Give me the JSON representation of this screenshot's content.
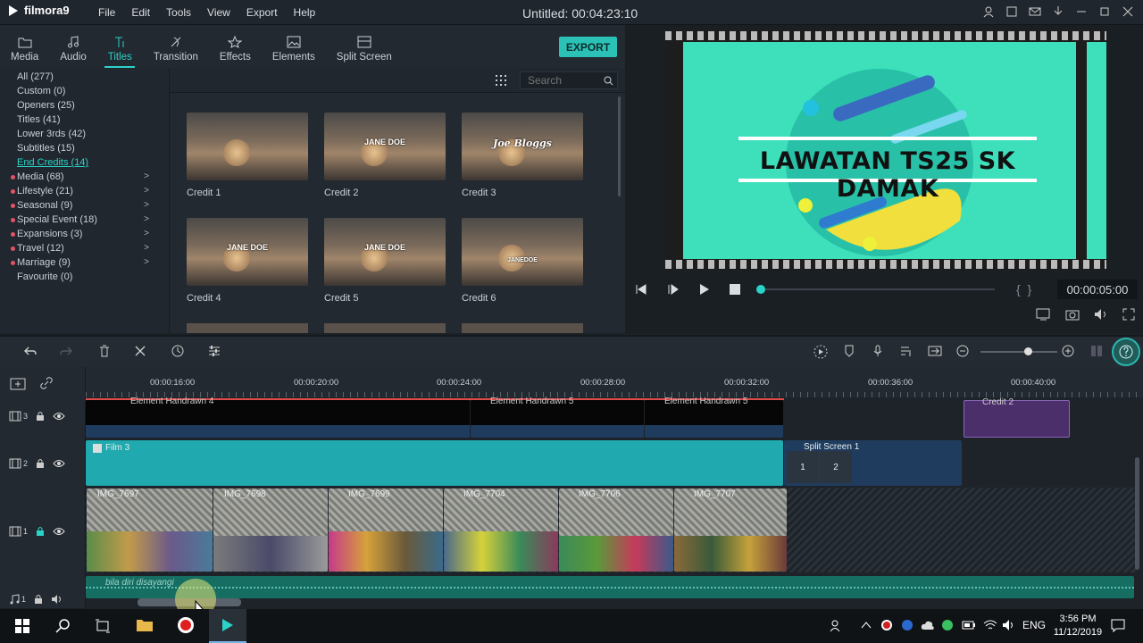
{
  "app": {
    "name": "filmora9",
    "title": "Untitled:",
    "time": "00:04:23:10"
  },
  "menu": [
    "File",
    "Edit",
    "Tools",
    "View",
    "Export",
    "Help"
  ],
  "tabs": [
    {
      "label": "Media",
      "icon": "folder-icon"
    },
    {
      "label": "Audio",
      "icon": "music-note-icon"
    },
    {
      "label": "Titles",
      "icon": "titles-icon"
    },
    {
      "label": "Transition",
      "icon": "transition-icon"
    },
    {
      "label": "Effects",
      "icon": "effects-icon"
    },
    {
      "label": "Elements",
      "icon": "image-icon"
    },
    {
      "label": "Split Screen",
      "icon": "split-screen-icon"
    }
  ],
  "export_label": "EXPORT",
  "categories": [
    {
      "label": "All (277)",
      "dot": false,
      "arrow": false
    },
    {
      "label": "Custom (0)",
      "dot": false,
      "arrow": false
    },
    {
      "label": "Openers (25)",
      "dot": false,
      "arrow": false
    },
    {
      "label": "Titles (41)",
      "dot": false,
      "arrow": false
    },
    {
      "label": "Lower 3rds (42)",
      "dot": false,
      "arrow": false
    },
    {
      "label": "Subtitles (15)",
      "dot": false,
      "arrow": false
    },
    {
      "label": "End Credits (14)",
      "dot": false,
      "arrow": false
    },
    {
      "label": "Media (68)",
      "dot": true,
      "arrow": true
    },
    {
      "label": "Lifestyle (21)",
      "dot": true,
      "arrow": true
    },
    {
      "label": "Seasonal (9)",
      "dot": true,
      "arrow": true
    },
    {
      "label": "Special Event (18)",
      "dot": true,
      "arrow": true
    },
    {
      "label": "Expansions (3)",
      "dot": true,
      "arrow": true
    },
    {
      "label": "Travel (12)",
      "dot": true,
      "arrow": true
    },
    {
      "label": "Marriage (9)",
      "dot": true,
      "arrow": true
    },
    {
      "label": "Favourite (0)",
      "dot": false,
      "arrow": false
    }
  ],
  "search_placeholder": "Search",
  "thumbs": [
    {
      "label": "Credit 1",
      "caption": ""
    },
    {
      "label": "Credit 2",
      "caption": "JANE DOE"
    },
    {
      "label": "Credit 3",
      "caption": "Joe Bloggs"
    },
    {
      "label": "Credit 4",
      "caption": "JANE DOE"
    },
    {
      "label": "Credit 5",
      "caption": "JANE DOE"
    },
    {
      "label": "Credit 6",
      "caption": "JANEDOE"
    }
  ],
  "preview": {
    "headline": "LAWATAN TS25 SK DAMAK",
    "timecode": "00:00:05:00"
  },
  "ruler": [
    "00:00:16:00",
    "00:00:20:00",
    "00:00:24:00",
    "00:00:28:00",
    "00:00:32:00",
    "00:00:36:00",
    "00:00:40:00"
  ],
  "tracks": [
    {
      "label": "3"
    },
    {
      "label": "2"
    },
    {
      "label": "1"
    },
    {
      "label": "1"
    }
  ],
  "clips": {
    "element1": "Element Handrawn 4",
    "element2": "Element Handrawn 5",
    "element3": "Element Handrawn 5",
    "credit": "Credit 2",
    "film": "Film 3",
    "split": "Split Screen 1",
    "split_a": "1",
    "split_b": "2",
    "img": [
      "IMG_7697",
      "IMG_7698",
      "IMG_7699",
      "IMG_7704",
      "IMG_7706",
      "IMG_7707"
    ],
    "audio": "bila diri disayangi"
  },
  "taskbar": {
    "lang": "ENG",
    "time": "3:56 PM",
    "date": "11/12/2019"
  },
  "colors": {
    "accent": "#2bd2c8",
    "preview_bg": "#3ee0bc",
    "film_clip": "#20a9ae",
    "audio_clip": "#166e63"
  }
}
